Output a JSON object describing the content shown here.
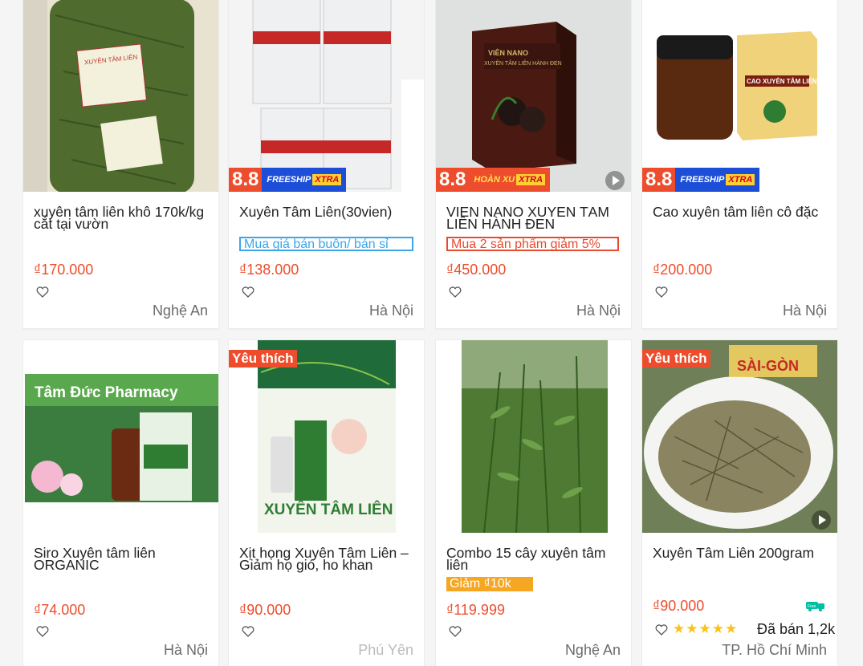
{
  "products": [
    {
      "title": "xuyên tâm liên khô 170k/kg cắt tại vườn",
      "price": "₫170.000",
      "location": "Nghệ An"
    },
    {
      "title": "Xuyên Tâm Liên(30vien)",
      "promo": "Mua giá bán buôn/ bán sỉ",
      "price": "₫138.000",
      "location": "Hà Nội",
      "badge_num": "8.8",
      "badge_tag": "FREESHIP",
      "badge_xtra": "XTRA"
    },
    {
      "title": "VIÊN NANO XUYÊN TÂM LIÊN HÀNH ĐEN",
      "promo": "Mua 2 sản phẩm giảm 5%",
      "price": "₫450.000",
      "location": "Hà Nội",
      "badge_num": "8.8",
      "badge_tag": "HOÀN XU",
      "badge_xtra": "XTRA"
    },
    {
      "title": "Cao xuyên tâm liên cô đặc",
      "price": "₫200.000",
      "location": "Hà Nội",
      "badge_num": "8.8",
      "badge_tag": "FREESHIP",
      "badge_xtra": "XTRA"
    },
    {
      "title": "Siro Xuyên tâm liên ORGANIC",
      "price": "₫74.000",
      "location": "Hà Nội",
      "img_text": "Tâm Đức Pharmacy"
    },
    {
      "title": "Xịt họng Xuyên Tâm Liên – Giảm họ gió, ho khan",
      "price": "₫90.000",
      "location": "Phú Yên",
      "fav": "Yêu thích",
      "img_text": "XUYÊN TÂM LIÊN"
    },
    {
      "title": "Combo 15 cây xuyên tâm liên",
      "promo": "Giảm ₫10k",
      "price": "₫119.999",
      "location": "Nghệ An"
    },
    {
      "title": "Xuyên Tâm Liên 200gram",
      "price": "₫90.000",
      "location": "TP. Hồ Chí Minh",
      "fav": "Yêu thích",
      "stars": "★★★★★",
      "sold": "Đã bán 1,2k",
      "img_text": "SÀI-GÒN"
    }
  ],
  "colors": {
    "accent": "#ee4d2d",
    "promo_blue": "#3aa7ea",
    "promo_orange": "#f5a623",
    "star": "#f7c21a"
  },
  "icons": [
    "heart-icon",
    "play-icon",
    "free-ship-icon"
  ]
}
